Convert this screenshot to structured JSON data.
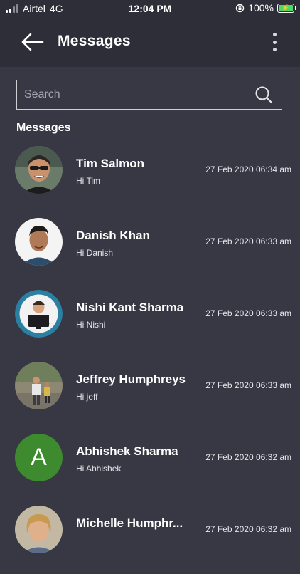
{
  "status_bar": {
    "carrier": "Airtel",
    "network": "4G",
    "time": "12:04 PM",
    "battery": "100%"
  },
  "header": {
    "title": "Messages"
  },
  "search": {
    "placeholder": "Search"
  },
  "section_label": "Messages",
  "messages": [
    {
      "name": "Tim  Salmon",
      "preview": "Hi Tim",
      "time": "27 Feb 2020 06:34 am"
    },
    {
      "name": "Danish  Khan",
      "preview": "Hi Danish",
      "time": "27 Feb 2020 06:33 am"
    },
    {
      "name": "Nishi  Kant Sharma",
      "preview": "Hi Nishi",
      "time": "27 Feb 2020 06:33 am"
    },
    {
      "name": "Jeffrey  Humphreys",
      "preview": "Hi jeff",
      "time": "27 Feb 2020 06:33 am"
    },
    {
      "name": "Abhishek  Sharma",
      "preview": "Hi Abhishek",
      "time": "27 Feb 2020 06:32 am",
      "avatar_letter": "A"
    },
    {
      "name": "Michelle  Humphr...",
      "preview": "",
      "time": "27 Feb 2020 06:32 am"
    }
  ],
  "colors": {
    "background": "#383845",
    "header": "#2e2e38",
    "avatar_green": "#3e8a2e",
    "battery_green": "#4cd964"
  }
}
